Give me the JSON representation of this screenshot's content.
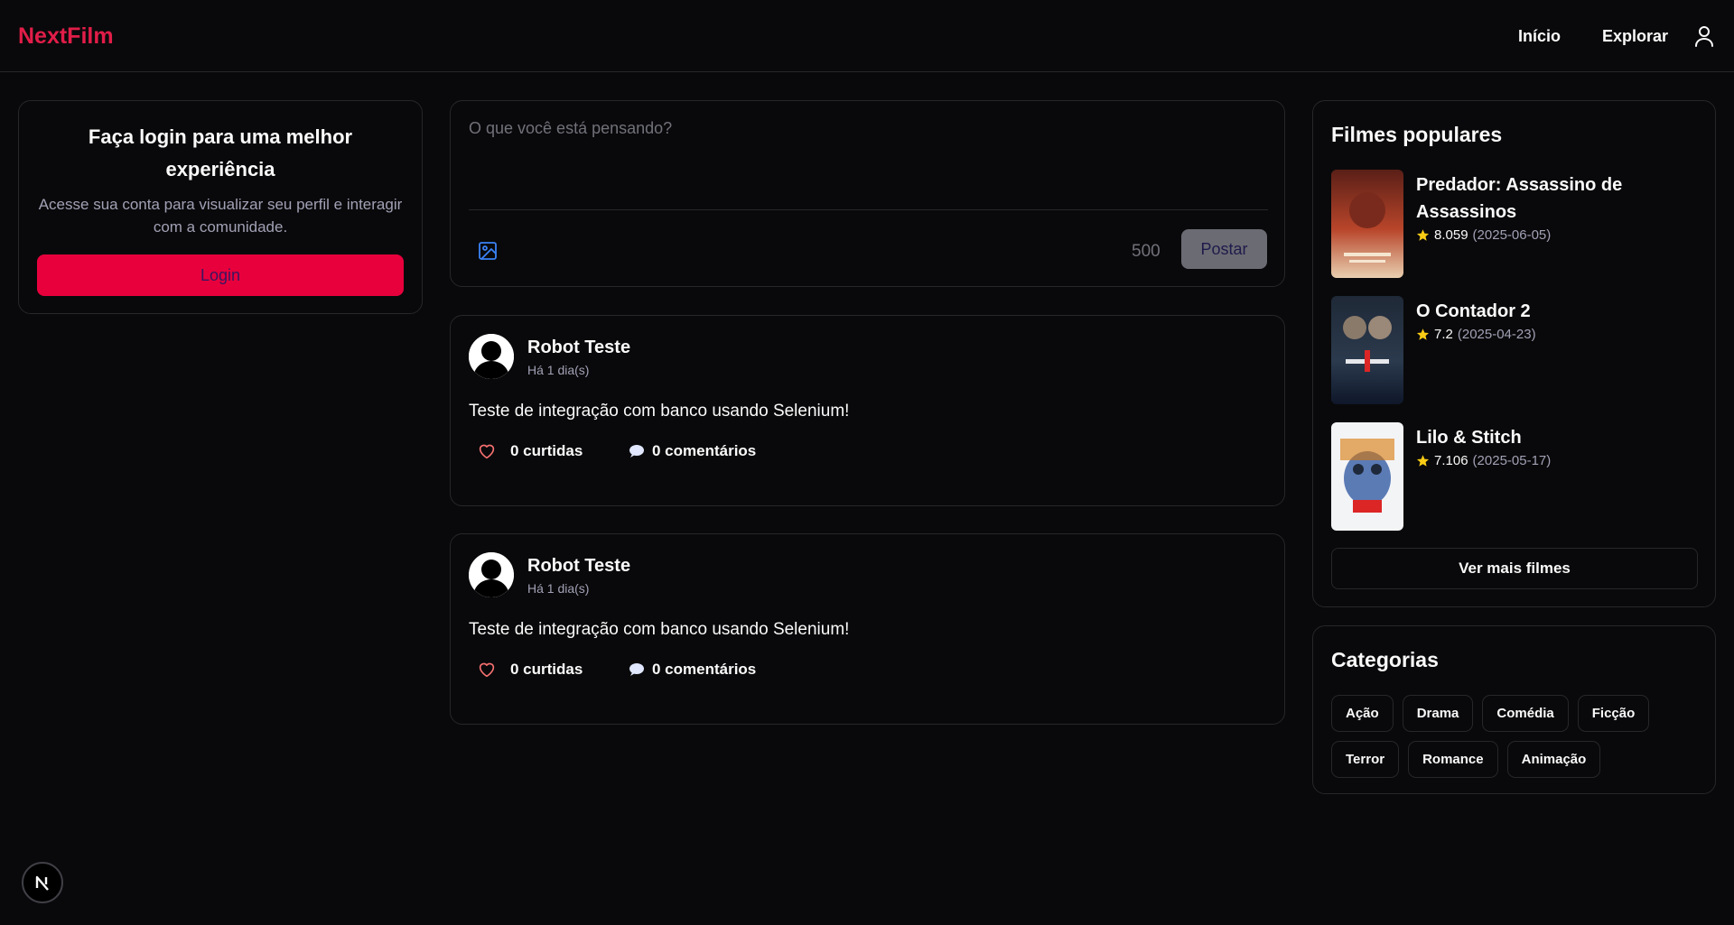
{
  "header": {
    "logo": "NextFilm",
    "nav": {
      "home": "Início",
      "explore": "Explorar"
    },
    "user_icon": "user-icon"
  },
  "login_card": {
    "title": "Faça login para uma melhor experiência",
    "description": "Acesse sua conta para visualizar seu perfil e interagir com a comunidade.",
    "button": "Login"
  },
  "composer": {
    "placeholder": "O que você está pensando?",
    "image_icon": "image-icon",
    "char_count": "500",
    "post_button": "Postar"
  },
  "posts": [
    {
      "author": "Robot Teste",
      "time": "Há 1 dia(s)",
      "text": "Teste de integração com banco usando Selenium!",
      "likes": "0 curtidas",
      "comments": "0 comentários"
    },
    {
      "author": "Robot Teste",
      "time": "Há 1 dia(s)",
      "text": "Teste de integração com banco usando Selenium!",
      "likes": "0 curtidas",
      "comments": "0 comentários"
    }
  ],
  "popular": {
    "title": "Filmes populares",
    "movies": [
      {
        "title": "Predador: Assassino de Assassinos",
        "rating": "8.059",
        "date": "(2025-06-05)"
      },
      {
        "title": "O Contador 2",
        "rating": "7.2",
        "date": "(2025-04-23)"
      },
      {
        "title": "Lilo & Stitch",
        "rating": "7.106",
        "date": "(2025-05-17)"
      }
    ],
    "more_button": "Ver mais filmes"
  },
  "categories": {
    "title": "Categorias",
    "items": [
      "Ação",
      "Drama",
      "Comédia",
      "Ficção",
      "Terror",
      "Romance",
      "Animação"
    ]
  },
  "next_badge": "N",
  "colors": {
    "brand": "#e11d48",
    "login_button": "#e8003d",
    "star": "#facc15",
    "background": "#09090b",
    "border": "#27272a"
  }
}
